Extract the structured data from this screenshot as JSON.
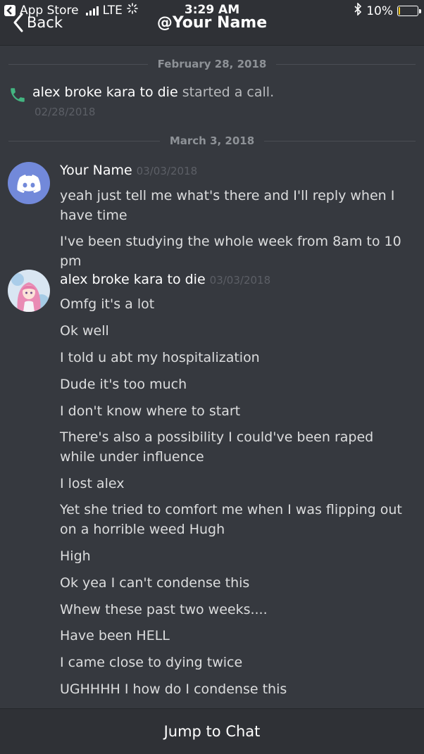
{
  "status_bar": {
    "back_app": "App Store",
    "carrier": "LTE",
    "time": "3:29 AM",
    "battery": "10%",
    "battery_level": 0.1,
    "bluetooth_icon": "bluetooth-icon"
  },
  "header": {
    "back_label": "Back",
    "title": "@Your Name"
  },
  "dividers": [
    "February 28, 2018",
    "March 3, 2018"
  ],
  "call_event": {
    "who": "alex broke kara to die",
    "what": " started a call.",
    "date": "02/28/2018",
    "icon": "phone-icon"
  },
  "groups": [
    {
      "author": "Your Name",
      "timestamp": "03/03/2018",
      "avatar": "discord-logo-avatar",
      "messages": [
        "yeah just tell me what's there and I'll reply when I have time",
        "I've been studying the whole week from 8am to 10 pm"
      ]
    },
    {
      "author": "alex broke kara to die",
      "timestamp": "03/03/2018",
      "avatar": "anime-girl-avatar",
      "messages": [
        "Omfg it's a lot",
        "Ok well",
        "I told u abt my hospitalization",
        "Dude it's too much",
        "I don't know where to start",
        "There's also a possibility I could've been raped while under influence",
        "I lost alex",
        "Yet she tried to comfort me when I was flipping out on a horrible weed Hugh",
        "High",
        "Ok yea I can't condense this",
        "Whew these past two weeks....",
        "Have been HELL",
        "I came close to dying twice",
        "UGHHHH I how do I condense this"
      ]
    }
  ],
  "footer": {
    "jump_label": "Jump to Chat"
  },
  "colors": {
    "background": "#36393f",
    "bar": "#2f3136",
    "blurple": "#7289da",
    "call_green": "#43b581",
    "battery_yellow": "#f0c419"
  }
}
